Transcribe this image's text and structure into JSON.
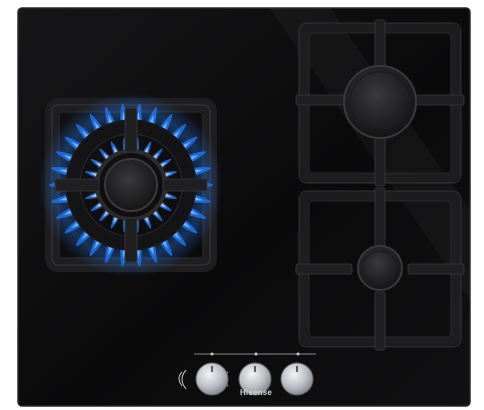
{
  "brand": "Hisense",
  "colors": {
    "glass": "#0b0b0c",
    "glass_edge": "#2a2a2c",
    "trivet": "#1c1c1e",
    "trivet_edge": "#333336",
    "flame_outer": "#1f6fe0",
    "flame_core": "#7cc4ff",
    "burner_cap": "#232325",
    "knob_metal": "#bfc3c8"
  },
  "burners": [
    {
      "name": "front-left-burner",
      "lit": true
    },
    {
      "name": "rear-right-burner",
      "lit": false
    },
    {
      "name": "front-right-burner",
      "lit": false
    }
  ],
  "controls": {
    "knob_count": 3
  }
}
